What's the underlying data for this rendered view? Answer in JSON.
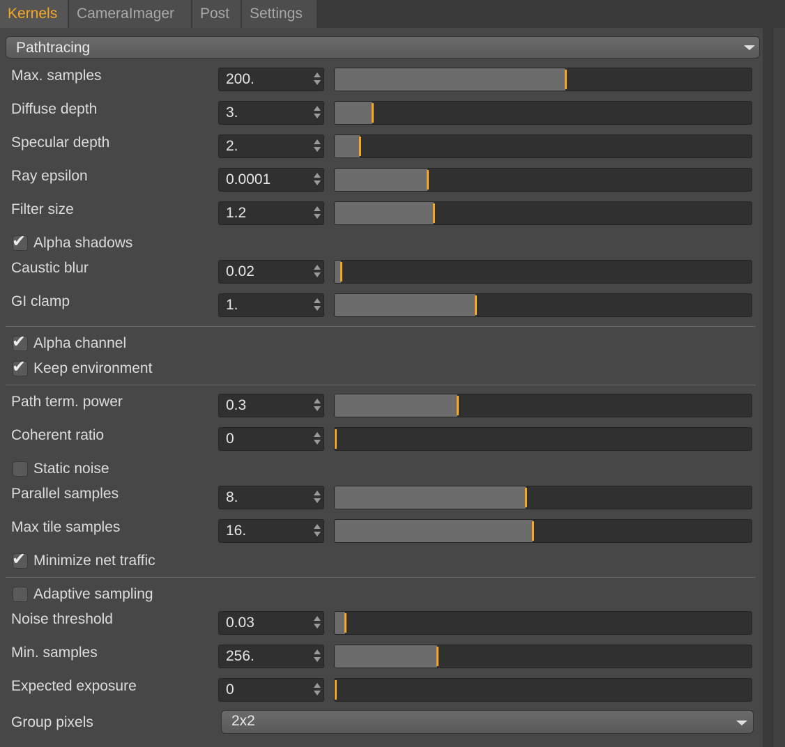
{
  "tabs": [
    {
      "label": "Kernels",
      "active": true
    },
    {
      "label": "CameraImager",
      "active": false
    },
    {
      "label": "Post",
      "active": false
    },
    {
      "label": "Settings",
      "active": false
    }
  ],
  "section": {
    "title": "Pathtracing"
  },
  "params": {
    "max_samples": {
      "label": "Max. samples",
      "value": "200.",
      "slider_fraction": 0.553
    },
    "diffuse_depth": {
      "label": "Diffuse depth",
      "value": "3.",
      "slider_fraction": 0.09
    },
    "specular_depth": {
      "label": "Specular depth",
      "value": "2.",
      "slider_fraction": 0.06
    },
    "ray_epsilon": {
      "label": "Ray epsilon",
      "value": "0.0001",
      "slider_fraction": 0.223
    },
    "filter_size": {
      "label": "Filter size",
      "value": "1.2",
      "slider_fraction": 0.237
    },
    "caustic_blur": {
      "label": "Caustic blur",
      "value": "0.02",
      "slider_fraction": 0.015
    },
    "gi_clamp": {
      "label": "GI clamp",
      "value": "1.",
      "slider_fraction": 0.337
    },
    "path_term_power": {
      "label": "Path term. power",
      "value": "0.3",
      "slider_fraction": 0.295
    },
    "coherent_ratio": {
      "label": "Coherent ratio",
      "value": "0",
      "slider_fraction": 0.0
    },
    "parallel_samples": {
      "label": "Parallel samples",
      "value": "8.",
      "slider_fraction": 0.458
    },
    "max_tile_samples": {
      "label": "Max tile samples",
      "value": "16.",
      "slider_fraction": 0.475
    },
    "noise_threshold": {
      "label": "Noise threshold",
      "value": "0.03",
      "slider_fraction": 0.025
    },
    "min_samples": {
      "label": "Min. samples",
      "value": "256.",
      "slider_fraction": 0.245
    },
    "expected_exposure": {
      "label": "Expected exposure",
      "value": "0",
      "slider_fraction": 0.0
    }
  },
  "checks": {
    "alpha_shadows": {
      "label": "Alpha shadows",
      "checked": true
    },
    "alpha_channel": {
      "label": "Alpha channel",
      "checked": true
    },
    "keep_environment": {
      "label": "Keep environment",
      "checked": true
    },
    "static_noise": {
      "label": "Static noise",
      "checked": false
    },
    "minimize_net_traffic": {
      "label": "Minimize net traffic",
      "checked": true
    },
    "adaptive_sampling": {
      "label": "Adaptive sampling",
      "checked": false
    }
  },
  "group_pixels": {
    "label": "Group pixels",
    "value": "2x2"
  },
  "colors": {
    "accent": "#f5a623",
    "background": "#474747",
    "field": "#303030",
    "slider_fill": "#6c6c6c"
  },
  "glyphs": {
    "checkmark": "✔"
  }
}
